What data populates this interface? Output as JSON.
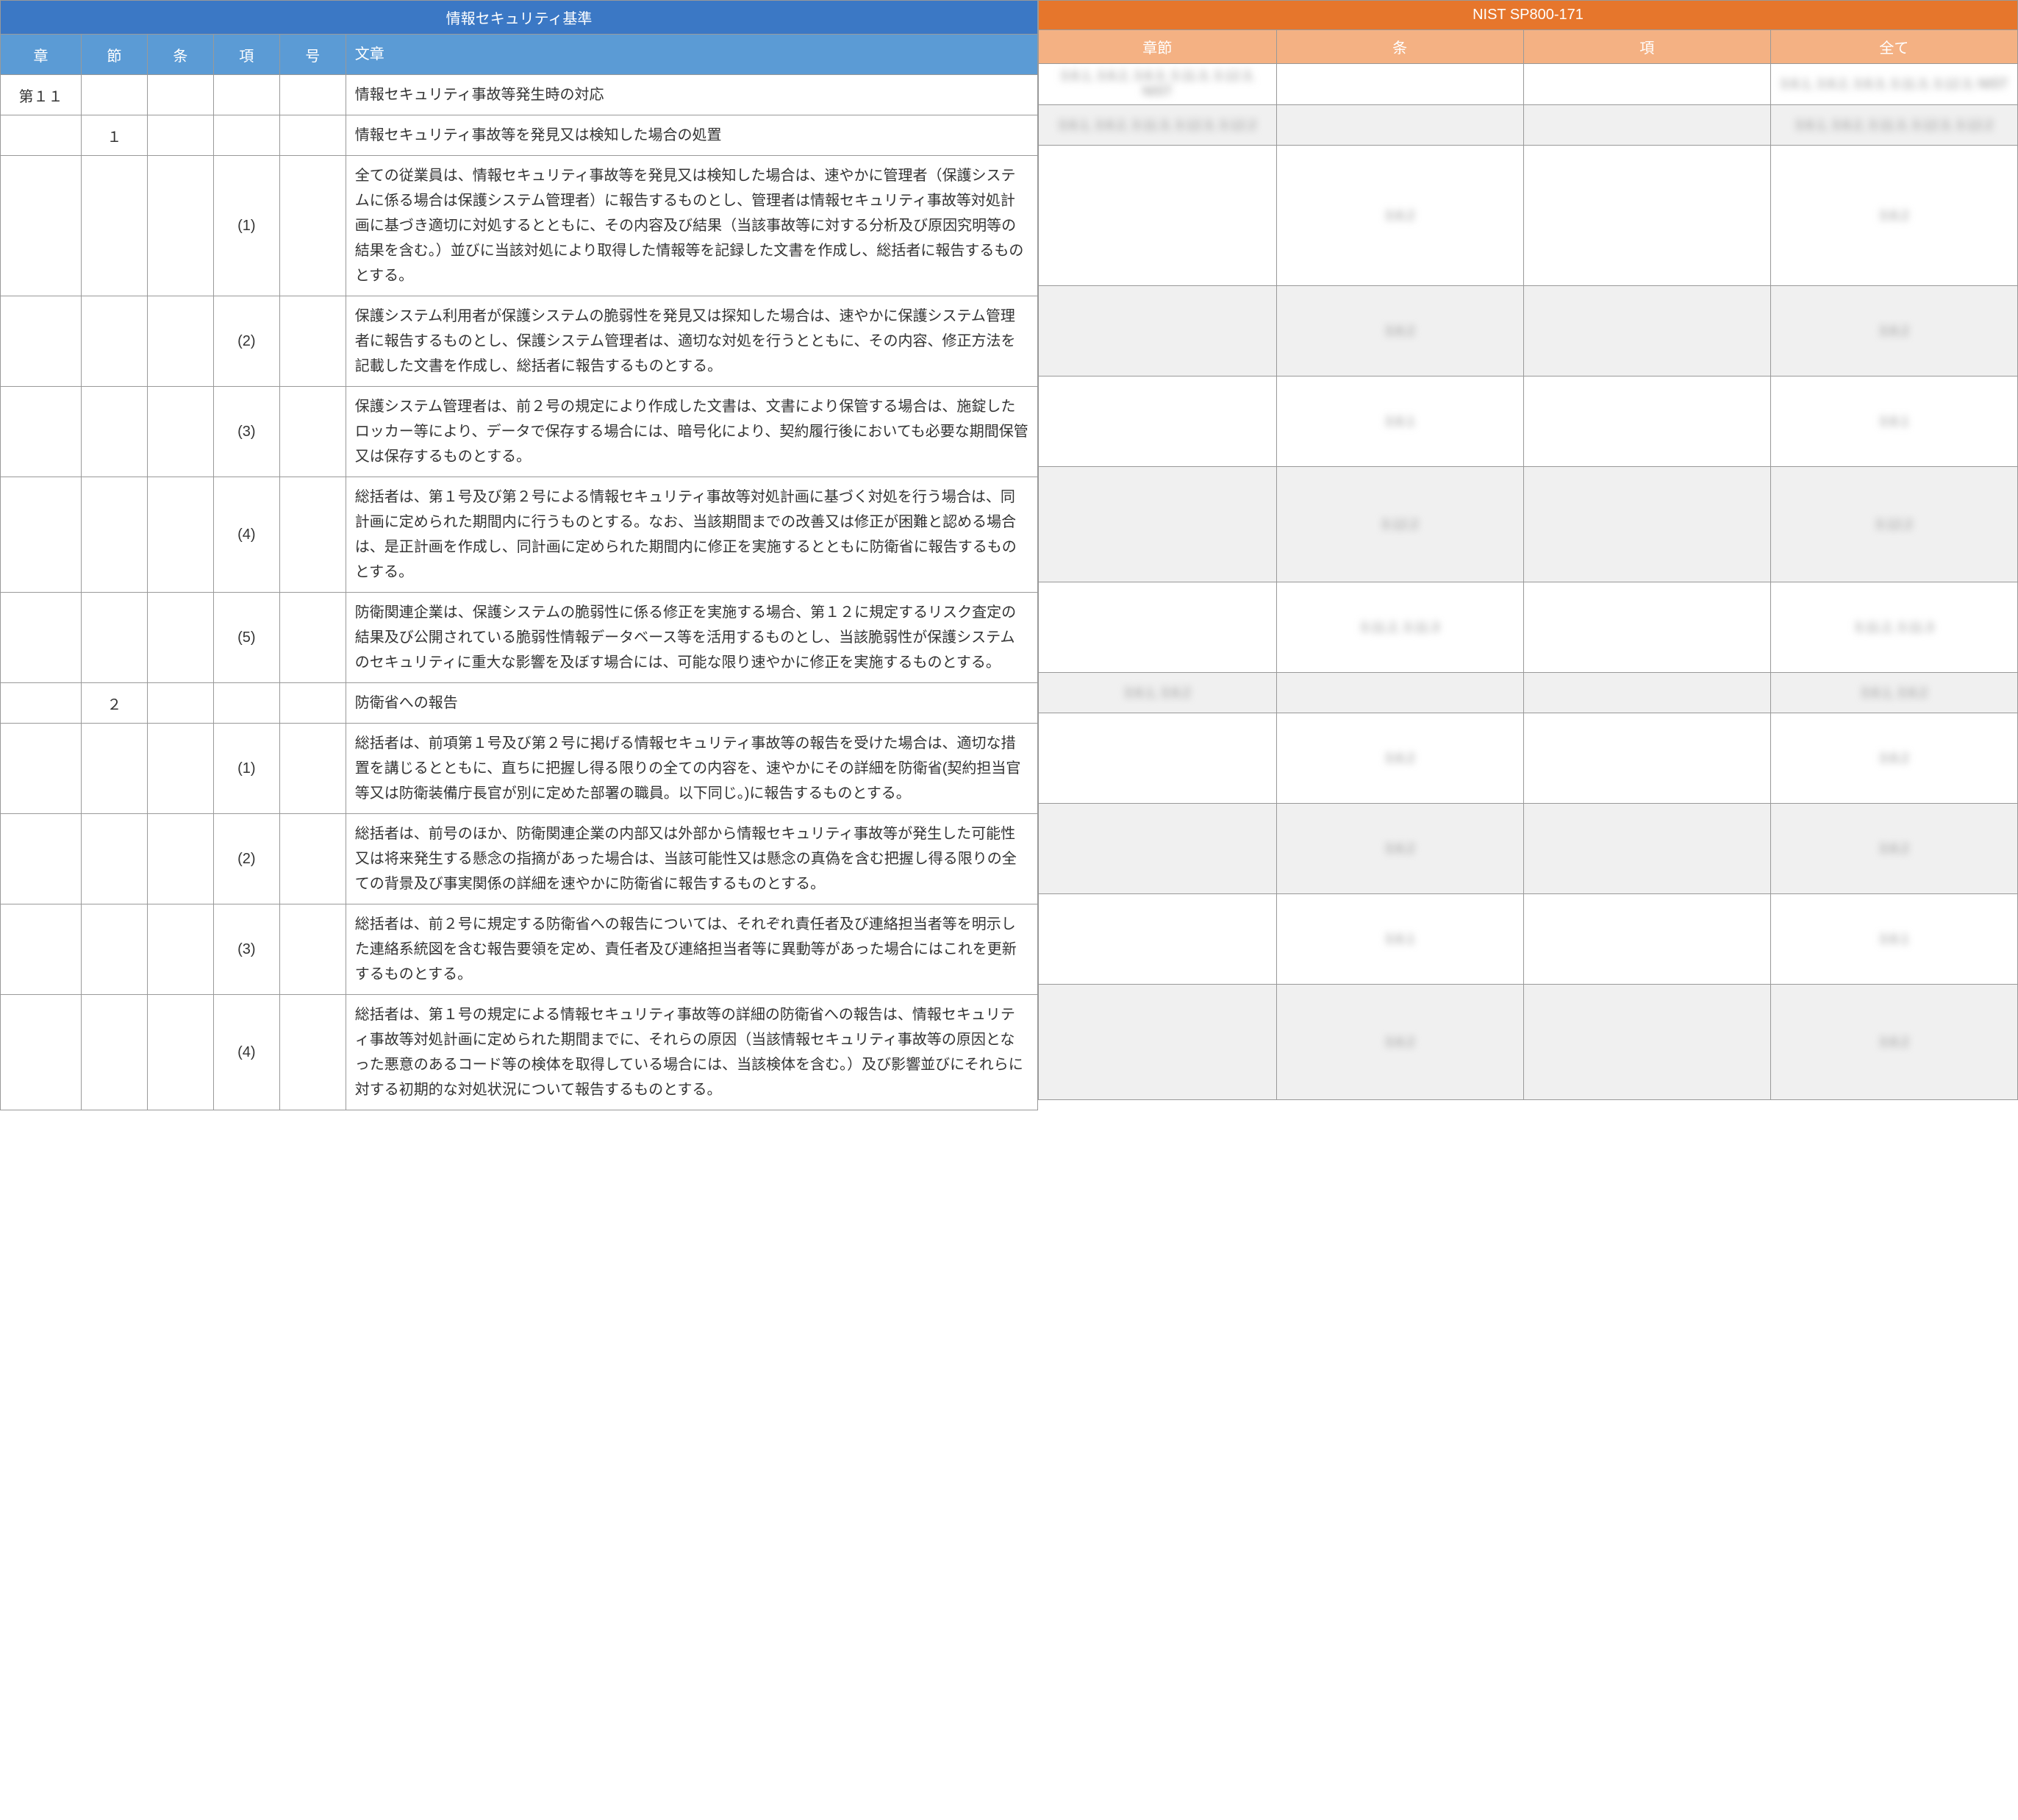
{
  "left": {
    "title": "情報セキュリティ基準",
    "headers": {
      "sho": "章",
      "setsu": "節",
      "jo": "条",
      "kou": "項",
      "go": "号",
      "bunsho": "文章"
    },
    "rows": [
      {
        "sho": "第１１",
        "setsu": "",
        "jo": "",
        "kou": "",
        "go": "",
        "text": "情報セキュリティ事故等発生時の対応",
        "shade": "w",
        "r": {
          "c1": "3.6.1, 3.6.2, 3.6.3, 3.11.3, 3.12.3, NIST",
          "c2": "",
          "c3": "",
          "c4": "3.6.1, 3.6.2, 3.6.3, 3.11.3, 3.12.3, NIST"
        }
      },
      {
        "sho": "",
        "setsu": "１",
        "jo": "",
        "kou": "",
        "go": "",
        "text": "情報セキュリティ事故等を発見又は検知した場合の処置",
        "shade": "g",
        "r": {
          "c1": "3.6.1, 3.6.2, 3.11.3, 3.12.3, 3.12.2",
          "c2": "",
          "c3": "",
          "c4": "3.6.1, 3.6.2, 3.11.3, 3.12.3, 3.12.2"
        }
      },
      {
        "sho": "",
        "setsu": "",
        "jo": "",
        "kou": "(1)",
        "go": "",
        "text": "全ての従業員は、情報セキュリティ事故等を発見又は検知した場合は、速やかに管理者（保護システムに係る場合は保護システム管理者）に報告するものとし、管理者は情報セキュリティ事故等対処計画に基づき適切に対処するとともに、その内容及び結果（当該事故等に対する分析及び原因究明等の結果を含む。）並びに当該対処により取得した情報等を記録した文書を作成し、総括者に報告するものとする。",
        "shade": "w",
        "r": {
          "c1": "",
          "c2": "3.6.2",
          "c3": "",
          "c4": "3.6.2"
        }
      },
      {
        "sho": "",
        "setsu": "",
        "jo": "",
        "kou": "(2)",
        "go": "",
        "text": "保護システム利用者が保護システムの脆弱性を発見又は探知した場合は、速やかに保護システム管理者に報告するものとし、保護システム管理者は、適切な対処を行うとともに、その内容、修正方法を記載した文書を作成し、総括者に報告するものとする。",
        "shade": "g",
        "r": {
          "c1": "",
          "c2": "3.6.2",
          "c3": "",
          "c4": "3.6.2"
        }
      },
      {
        "sho": "",
        "setsu": "",
        "jo": "",
        "kou": "(3)",
        "go": "",
        "text": "保護システム管理者は、前２号の規定により作成した文書は、文書により保管する場合は、施錠したロッカー等により、データで保存する場合には、暗号化により、契約履行後においても必要な期間保管又は保存するものとする。",
        "shade": "w",
        "r": {
          "c1": "",
          "c2": "3.6.1",
          "c3": "",
          "c4": "3.6.1"
        }
      },
      {
        "sho": "",
        "setsu": "",
        "jo": "",
        "kou": "(4)",
        "go": "",
        "text": "総括者は、第１号及び第２号による情報セキュリティ事故等対処計画に基づく対処を行う場合は、同計画に定められた期間内に行うものとする。なお、当該期間までの改善又は修正が困難と認める場合は、是正計画を作成し、同計画に定められた期間内に修正を実施するとともに防衛省に報告するものとする。",
        "shade": "g",
        "r": {
          "c1": "",
          "c2": "3.12.2",
          "c3": "",
          "c4": "3.12.2"
        }
      },
      {
        "sho": "",
        "setsu": "",
        "jo": "",
        "kou": "(5)",
        "go": "",
        "text": "防衛関連企業は、保護システムの脆弱性に係る修正を実施する場合、第１２に規定するリスク査定の結果及び公開されている脆弱性情報データベース等を活用するものとし、当該脆弱性が保護システムのセキュリティに重大な影響を及ぼす場合には、可能な限り速やかに修正を実施するものとする。",
        "shade": "w",
        "r": {
          "c1": "",
          "c2": "3.11.2, 3.11.3",
          "c3": "",
          "c4": "3.11.2, 3.11.3"
        }
      },
      {
        "sho": "",
        "setsu": "２",
        "jo": "",
        "kou": "",
        "go": "",
        "text": "防衛省への報告",
        "shade": "g",
        "r": {
          "c1": "3.6.1, 3.6.2",
          "c2": "",
          "c3": "",
          "c4": "3.6.1, 3.6.2"
        }
      },
      {
        "sho": "",
        "setsu": "",
        "jo": "",
        "kou": "(1)",
        "go": "",
        "text": "総括者は、前項第１号及び第２号に掲げる情報セキュリティ事故等の報告を受けた場合は、適切な措置を講じるとともに、直ちに把握し得る限りの全ての内容を、速やかにその詳細を防衛省(契約担当官等又は防衛装備庁長官が別に定めた部署の職員。以下同じ。)に報告するものとする。",
        "shade": "w",
        "r": {
          "c1": "",
          "c2": "3.6.2",
          "c3": "",
          "c4": "3.6.2"
        }
      },
      {
        "sho": "",
        "setsu": "",
        "jo": "",
        "kou": "(2)",
        "go": "",
        "text": "総括者は、前号のほか、防衛関連企業の内部又は外部から情報セキュリティ事故等が発生した可能性又は将来発生する懸念の指摘があった場合は、当該可能性又は懸念の真偽を含む把握し得る限りの全ての背景及び事実関係の詳細を速やかに防衛省に報告するものとする。",
        "shade": "g",
        "r": {
          "c1": "",
          "c2": "3.6.2",
          "c3": "",
          "c4": "3.6.2"
        }
      },
      {
        "sho": "",
        "setsu": "",
        "jo": "",
        "kou": "(3)",
        "go": "",
        "text": "総括者は、前２号に規定する防衛省への報告については、それぞれ責任者及び連絡担当者等を明示した連絡系統図を含む報告要領を定め、責任者及び連絡担当者等に異動等があった場合にはこれを更新するものとする。",
        "shade": "w",
        "r": {
          "c1": "",
          "c2": "3.6.1",
          "c3": "",
          "c4": "3.6.1"
        }
      },
      {
        "sho": "",
        "setsu": "",
        "jo": "",
        "kou": "(4)",
        "go": "",
        "text": "総括者は、第１号の規定による情報セキュリティ事故等の詳細の防衛省への報告は、情報セキュリティ事故等対処計画に定められた期間までに、それらの原因（当該情報セキュリティ事故等の原因となった悪意のあるコード等の検体を取得している場合には、当該検体を含む。）及び影響並びにそれらに対する初期的な対処状況について報告するものとする。",
        "shade": "g",
        "r": {
          "c1": "",
          "c2": "3.6.2",
          "c3": "",
          "c4": "3.6.2"
        }
      }
    ]
  },
  "right": {
    "title": "NIST SP800-171",
    "headers": {
      "c1": "章節",
      "c2": "条",
      "c3": "項",
      "c4": "全て"
    }
  }
}
